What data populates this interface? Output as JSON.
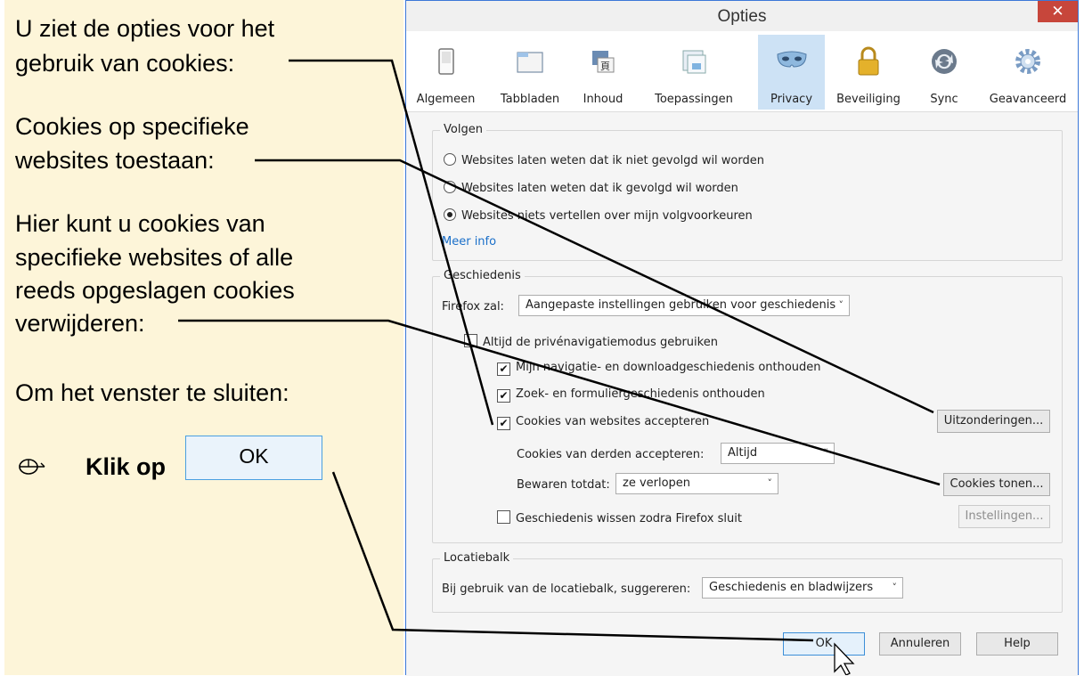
{
  "instructions": {
    "line1a": "U ziet de opties voor het",
    "line1b": "gebruik van cookies:",
    "line2a": "Cookies op specifieke",
    "line2b": "websites toestaan:",
    "line3a": "Hier kunt u cookies van",
    "line3b": "specifieke websites of alle",
    "line3c": "reeds opgeslagen cookies",
    "line3d": "verwijderen:",
    "line4": "Om het venster te sluiten:",
    "klik": "Klik op",
    "ok_sample": "OK"
  },
  "dialog": {
    "title": "Opties",
    "close": "✕",
    "tabs": [
      {
        "label": "Algemeen",
        "icon": "switch-icon"
      },
      {
        "label": "Tabbladen",
        "icon": "tabs-icon"
      },
      {
        "label": "Inhoud",
        "icon": "content-icon"
      },
      {
        "label": "Toepassingen",
        "icon": "applications-icon"
      },
      {
        "label": "Privacy",
        "icon": "mask-icon"
      },
      {
        "label": "Beveiliging",
        "icon": "lock-icon"
      },
      {
        "label": "Sync",
        "icon": "sync-icon"
      },
      {
        "label": "Geavanceerd",
        "icon": "gear-icon"
      }
    ],
    "active_tab": "Privacy",
    "tracking": {
      "legend": "Volgen",
      "opt1": "Websites laten weten dat ik niet gevolgd wil worden",
      "opt2": "Websites laten weten dat ik gevolgd wil worden",
      "opt3": "Websites niets vertellen over mijn volgvoorkeuren",
      "more_info": "Meer info"
    },
    "history": {
      "legend": "Geschiedenis",
      "firefox_label": "Firefox zal:",
      "firefox_value": "Aangepaste instellingen gebruiken voor geschiedenis",
      "private": "Altijd de privénavigatiemodus gebruiken",
      "remember_nav": "Mijn navigatie- en downloadgeschiedenis onthouden",
      "remember_search": "Zoek- en formuliergeschiedenis onthouden",
      "accept_cookies": "Cookies van websites accepteren",
      "exceptions_btn": "Uitzonderingen...",
      "third_party_label": "Cookies van derden accepteren:",
      "third_party_value": "Altijd",
      "keep_label": "Bewaren totdat:",
      "keep_value": "ze verlopen",
      "show_cookies_btn": "Cookies tonen...",
      "clear_on_close": "Geschiedenis wissen zodra Firefox sluit",
      "settings_btn": "Instellingen..."
    },
    "locationbar": {
      "legend": "Locatiebalk",
      "label": "Bij gebruik van de locatiebalk, suggereren:",
      "value": "Geschiedenis en bladwijzers"
    },
    "buttons": {
      "ok": "OK",
      "cancel": "Annuleren",
      "help": "Help"
    }
  }
}
